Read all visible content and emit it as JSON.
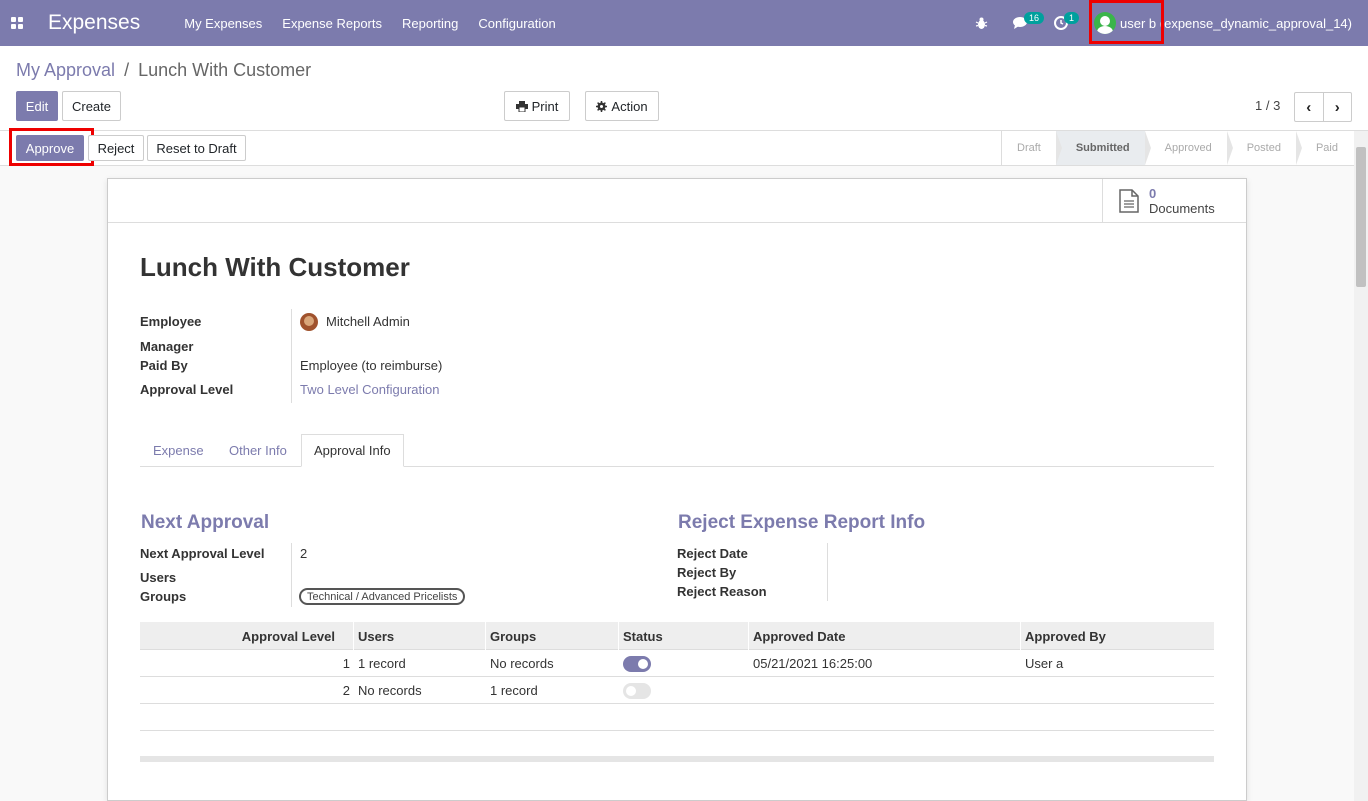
{
  "nav": {
    "app_name": "Expenses",
    "menu": [
      "My Expenses",
      "Expense Reports",
      "Reporting",
      "Configuration"
    ],
    "messages_count": "16",
    "activities_count": "1",
    "user": "user b (expense_dynamic_approval_14)"
  },
  "breadcrumb": {
    "parent": "My Approval",
    "separator": "/",
    "current": "Lunch With Customer"
  },
  "buttons": {
    "edit": "Edit",
    "create": "Create",
    "print": "Print",
    "action": "Action",
    "approve": "Approve",
    "reject": "Reject",
    "reset": "Reset to Draft"
  },
  "pager": {
    "text": "1 / 3",
    "prev": "‹",
    "next": "›"
  },
  "stages": [
    "Draft",
    "Submitted",
    "Approved",
    "Posted",
    "Paid"
  ],
  "active_stage": "Submitted",
  "documents": {
    "count": "0",
    "label": "Documents"
  },
  "record": {
    "title": "Lunch With Customer",
    "fields": {
      "employee_label": "Employee",
      "employee_value": "Mitchell Admin",
      "manager_label": "Manager",
      "manager_value": "",
      "paid_by_label": "Paid By",
      "paid_by_value": "Employee (to reimburse)",
      "approval_level_label": "Approval Level",
      "approval_level_value": "Two Level Configuration"
    }
  },
  "tabs": [
    "Expense",
    "Other Info",
    "Approval Info"
  ],
  "active_tab": "Approval Info",
  "next_approval": {
    "title": "Next Approval",
    "level_label": "Next Approval Level",
    "level_value": "2",
    "users_label": "Users",
    "users_value": "",
    "groups_label": "Groups",
    "groups_tag": "Technical / Advanced Pricelists"
  },
  "reject_info": {
    "title": "Reject Expense Report Info",
    "date_label": "Reject Date",
    "by_label": "Reject By",
    "reason_label": "Reject Reason"
  },
  "approval_table": {
    "columns": [
      "Approval Level",
      "Users",
      "Groups",
      "Status",
      "Approved Date",
      "Approved By"
    ],
    "rows": [
      {
        "level": "1",
        "users": "1 record",
        "groups": "No records",
        "status": true,
        "approved_date": "05/21/2021 16:25:00",
        "approved_by": "User a"
      },
      {
        "level": "2",
        "users": "No records",
        "groups": "1 record",
        "status": false,
        "approved_date": "",
        "approved_by": ""
      }
    ]
  },
  "colors": {
    "primary": "#7c7bad",
    "highlight": "#e00000",
    "badge": "#00a09d"
  }
}
